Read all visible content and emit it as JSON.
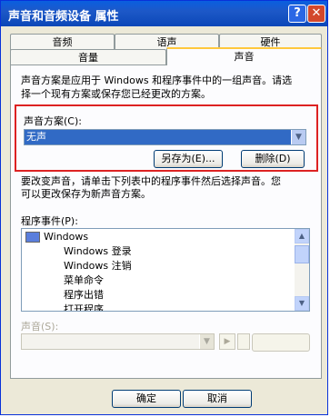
{
  "window": {
    "title": "声音和音频设备 属性",
    "help_label": "?",
    "close_label": "✕"
  },
  "tabs": [
    {
      "label": "音频"
    },
    {
      "label": "语声"
    },
    {
      "label": "硬件"
    },
    {
      "label": "音量"
    },
    {
      "label": "声音"
    }
  ],
  "description": {
    "line1": "声音方案是应用于 Windows 和程序事件中的一组声音。请选",
    "line2": "择一个现有方案或保存您已经更改的方案。"
  },
  "scheme": {
    "label": "声音方案(C):",
    "value": "无声",
    "save_as_label": "另存为(E)...",
    "delete_label": "删除(D)"
  },
  "change_description": {
    "line1": "要改变声音，请单击下列表中的程序事件然后选择声音。您",
    "line2": "可以更改保存为新声音方案。"
  },
  "events": {
    "label": "程序事件(P):",
    "items": [
      {
        "label": "Windows"
      },
      {
        "label": "Windows 登录"
      },
      {
        "label": "Windows 注销"
      },
      {
        "label": "菜单命令"
      },
      {
        "label": "程序出错"
      },
      {
        "label": "打开程序"
      }
    ]
  },
  "sounds": {
    "label": "声音(S):",
    "value": ""
  },
  "footer": {
    "ok_label": "确定",
    "cancel_label": "取消"
  }
}
